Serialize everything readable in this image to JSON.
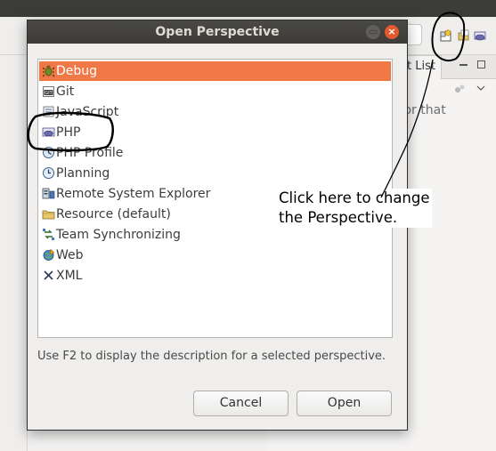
{
  "dialog": {
    "title": "Open Perspective",
    "minimize_glyph": "▭",
    "close_glyph": "×",
    "description": "Use F2 to display the description for a selected perspective.",
    "cancel_label": "Cancel",
    "open_label": "Open",
    "selected_index": 0,
    "perspectives": [
      {
        "label": "Debug",
        "icon": "bug-icon"
      },
      {
        "label": "Git",
        "icon": "git-icon"
      },
      {
        "label": "JavaScript",
        "icon": "javascript-icon"
      },
      {
        "label": "PHP",
        "icon": "php-icon"
      },
      {
        "label": "PHP Profile",
        "icon": "php-profile-icon"
      },
      {
        "label": "Planning",
        "icon": "planning-icon"
      },
      {
        "label": "Remote System Explorer",
        "icon": "remote-system-icon"
      },
      {
        "label": "Resource (default)",
        "icon": "folder-icon"
      },
      {
        "label": "Team Synchronizing",
        "icon": "team-sync-icon"
      },
      {
        "label": "Web",
        "icon": "web-icon"
      },
      {
        "label": "XML",
        "icon": "xml-icon"
      }
    ]
  },
  "background": {
    "pane_tab_label": "t List",
    "pane_text": "tor that"
  },
  "annotation": {
    "line1": "Click here to change",
    "line2": "the Perspective."
  },
  "colors": {
    "selection": "#f07746",
    "titlebar": "#3c3b37",
    "close_button": "#e2592f"
  }
}
